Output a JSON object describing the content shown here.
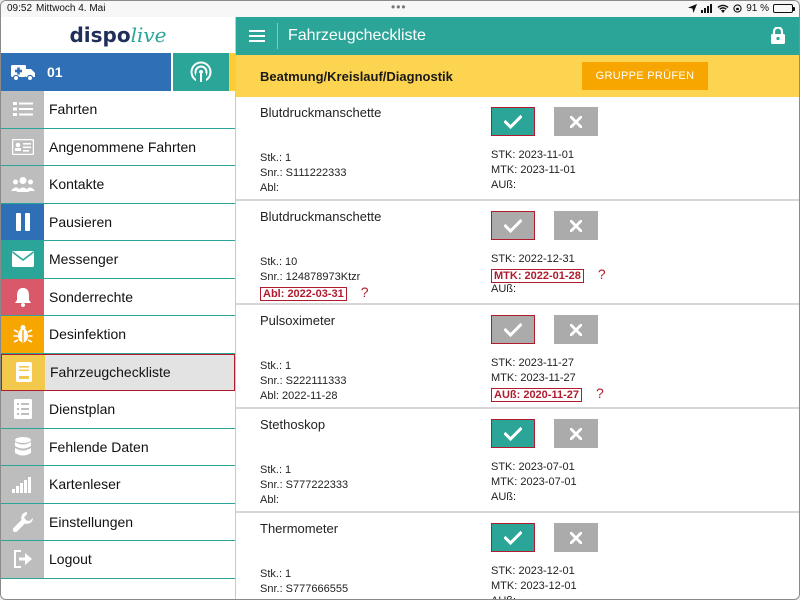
{
  "status_bar": {
    "time": "09:52",
    "date": "Mittwoch 4. Mai",
    "battery": "91 %",
    "battery_level": 0.91
  },
  "logo": {
    "part1": "dispo",
    "part2": "live"
  },
  "vehicle": {
    "number": "01"
  },
  "menu": [
    {
      "label": "Fahrten",
      "icon": "list-icon",
      "color": "#bdbdbd"
    },
    {
      "label": "Angenommene Fahrten",
      "icon": "id-card-icon",
      "color": "#bdbdbd"
    },
    {
      "label": "Kontakte",
      "icon": "contacts-icon",
      "color": "#bdbdbd"
    },
    {
      "label": "Pausieren",
      "icon": "pause-icon",
      "color": "#2e6fb6"
    },
    {
      "label": "Messenger",
      "icon": "mail-icon",
      "color": "#2ba598"
    },
    {
      "label": "Sonderrechte",
      "icon": "bell-icon",
      "color": "#d9596a"
    },
    {
      "label": "Desinfektion",
      "icon": "bug-icon",
      "color": "#f7a600"
    },
    {
      "label": "Fahrzeugcheckliste",
      "icon": "book-icon",
      "color": "#f2c94c",
      "active": true
    },
    {
      "label": "Dienstplan",
      "icon": "schedule-list-icon",
      "color": "#bdbdbd"
    },
    {
      "label": "Fehlende Daten",
      "icon": "database-icon",
      "color": "#bdbdbd"
    },
    {
      "label": "Kartenleser",
      "icon": "signal-bars-icon",
      "color": "#bdbdbd"
    },
    {
      "label": "Einstellungen",
      "icon": "wrench-icon",
      "color": "#bdbdbd"
    },
    {
      "label": "Logout",
      "icon": "logout-icon",
      "color": "#bdbdbd"
    }
  ],
  "header": {
    "title": "Fahrzeugcheckliste"
  },
  "group": {
    "title": "Beatmung/Kreislauf/Diagnostik",
    "button_label": "GRUPPE PRÜFEN"
  },
  "items": [
    {
      "name": "Blutdruckmanschette",
      "checked": true,
      "stk": "Stk.: 1",
      "snr": "Snr.: S111222333",
      "abl": "Abl:",
      "abl_flag": false,
      "stk_date": "STK: 2023-11-01",
      "stk_flag": false,
      "mtk": "MTK: 2023-11-01",
      "mtk_flag": false,
      "aus": "AUß:",
      "aus_flag": false
    },
    {
      "name": "Blutdruckmanschette",
      "checked": false,
      "stk": "Stk.: 10",
      "snr": "Snr.: 124878973Ktzr",
      "abl": "Abl: 2022-03-31",
      "abl_flag": true,
      "stk_date": "STK: 2022-12-31",
      "stk_flag": false,
      "mtk": "MTK: 2022-01-28",
      "mtk_flag": true,
      "aus": "AUß:",
      "aus_flag": false
    },
    {
      "name": "Pulsoximeter",
      "checked": false,
      "stk": "Stk.: 1",
      "snr": "Snr.: S222111333",
      "abl": "Abl: 2022-11-28",
      "abl_flag": false,
      "stk_date": "STK: 2023-11-27",
      "stk_flag": false,
      "mtk": "MTK: 2023-11-27",
      "mtk_flag": false,
      "aus": "AUß: 2020-11-27",
      "aus_flag": true
    },
    {
      "name": "Stethoskop",
      "checked": true,
      "stk": "Stk.: 1",
      "snr": "Snr.: S777222333",
      "abl": "Abl:",
      "abl_flag": false,
      "stk_date": "STK: 2023-07-01",
      "stk_flag": false,
      "mtk": "MTK: 2023-07-01",
      "mtk_flag": false,
      "aus": "AUß:",
      "aus_flag": false
    },
    {
      "name": "Thermometer",
      "checked": true,
      "stk": "Stk.: 1",
      "snr": "Snr.: S777666555",
      "abl": "Abl:",
      "abl_flag": false,
      "stk_date": "STK: 2023-12-01",
      "stk_flag": false,
      "mtk": "MTK: 2023-12-01",
      "mtk_flag": false,
      "aus": "AUß:",
      "aus_flag": false
    }
  ],
  "flag_mark": "?"
}
